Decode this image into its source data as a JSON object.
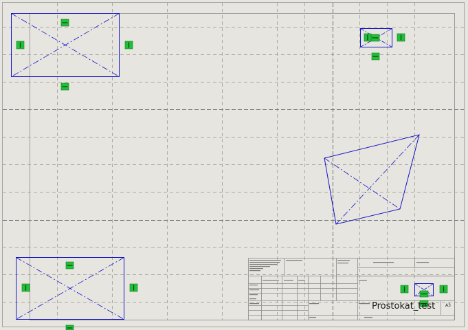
{
  "drawing": {
    "name": "Prostokat_test",
    "sheet_size": "A3"
  },
  "colors": {
    "background": "#e6e5df",
    "sheet_line": "#9a9a9a",
    "grid_line": "#8c8c8c",
    "geometry": "#1010c8",
    "relation_marker": "#22c03a"
  },
  "icons": {
    "horizontal_relation": "horizontal-relation-icon",
    "vertical_relation": "vertical-relation-icon"
  }
}
